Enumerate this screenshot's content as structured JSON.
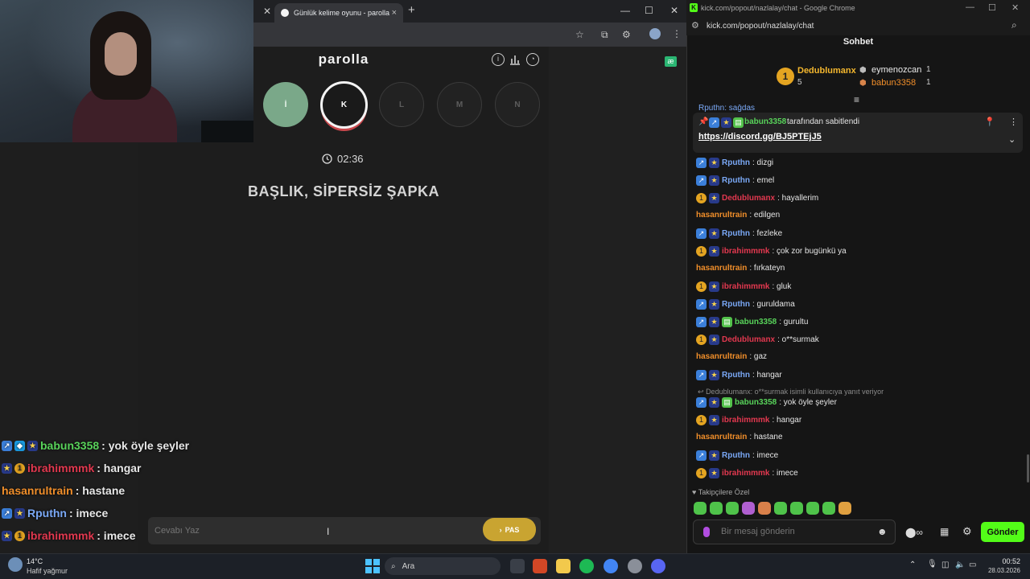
{
  "browser": {
    "tab_title": "Günlük kelime oyunu - parolla",
    "tab_close": "×",
    "new_tab": "+",
    "minimize": "—",
    "maximize": "☐",
    "close": "✕"
  },
  "game": {
    "logo": "parolla",
    "letters": [
      {
        "letter": "İ",
        "state": "done"
      },
      {
        "letter": "K",
        "state": "current"
      },
      {
        "letter": "L",
        "state": "todo"
      },
      {
        "letter": "M",
        "state": "todo"
      },
      {
        "letter": "N",
        "state": "todo"
      }
    ],
    "timer": "02:36",
    "clue": "BAŞLIK, SİPERSİZ ŞAPKA",
    "answer_placeholder": "Cevabı Yaz",
    "pass_label": "PAS",
    "pass_color": "#c9a431"
  },
  "overlay_chat": [
    {
      "user": "babun3358",
      "text": ": yok öyle şeyler",
      "color": "#58d35a"
    },
    {
      "user": "ibrahimmmk",
      "text": ": hangar",
      "color": "#e2384f"
    },
    {
      "user": "hasanrultrain",
      "text": ": hastane",
      "color": "#f08e2a"
    },
    {
      "user": "Rputhn",
      "text": ": imece",
      "color": "#7aa8f5"
    },
    {
      "user": "ibrahimmmk",
      "text": ": imece",
      "color": "#e2384f"
    }
  ],
  "chat": {
    "window_title": "kick.com/popout/nazlalay/chat - Google Chrome",
    "address": "kick.com/popout/nazlalay/chat",
    "header": "Sohbet",
    "leaderboard": {
      "first": {
        "rank": "1",
        "name": "Dedublumanx",
        "count": "5"
      },
      "second": {
        "name": "eymenozcan",
        "count": "1"
      },
      "third": {
        "name": "babun3358",
        "count": "1"
      }
    },
    "pinned": {
      "by_user": "babun3358",
      "by_text": "tarafından sabitlendi",
      "link": "https://discord.gg/BJ5PTEjJ5"
    },
    "partial_top": "Rputhn: sağdas",
    "messages": [
      {
        "user": "Rputhn",
        "text": ": dizgi",
        "cls": "u-blue"
      },
      {
        "user": "Rputhn",
        "text": ": emel",
        "cls": "u-blue"
      },
      {
        "user": "Dedublumanx",
        "text": ": hayallerim",
        "cls": "u-red"
      },
      {
        "user": "hasanrultrain",
        "text": ": edilgen",
        "cls": "u-orange"
      },
      {
        "user": "Rputhn",
        "text": ": fezleke",
        "cls": "u-blue"
      },
      {
        "user": "ibrahimmmk",
        "text": ": çok zor bugünkü ya",
        "cls": "u-red"
      },
      {
        "user": "hasanrultrain",
        "text": ": fırkateyn",
        "cls": "u-orange"
      },
      {
        "user": "ibrahimmmk",
        "text": ": gluk",
        "cls": "u-red"
      },
      {
        "user": "Rputhn",
        "text": ": guruldama",
        "cls": "u-blue"
      },
      {
        "user": "babun3358",
        "text": ": gurultu",
        "cls": "u-green"
      },
      {
        "user": "Dedublumanx",
        "text": ": o**surmak",
        "cls": "u-red"
      },
      {
        "user": "hasanrultrain",
        "text": ": gaz",
        "cls": "u-orange"
      },
      {
        "user": "Rputhn",
        "text": ": hangar",
        "cls": "u-blue"
      },
      {
        "user": "babun3358",
        "text": ": yok öyle şeyler",
        "cls": "u-green"
      },
      {
        "user": "ibrahimmmk",
        "text": ": hangar",
        "cls": "u-red"
      },
      {
        "user": "hasanrultrain",
        "text": ": hastane",
        "cls": "u-orange"
      },
      {
        "user": "Rputhn",
        "text": ": imece",
        "cls": "u-blue"
      },
      {
        "user": "ibrahimmmk",
        "text": ": imece",
        "cls": "u-red"
      }
    ],
    "reply_note": "Dedublumanx: o**surmak isimli kullanıcıya yanıt veriyor",
    "followers_only": "Takipçilere Özel",
    "input_placeholder": "Bir mesaj gönderin",
    "send_label": "Gönder",
    "send_color": "#53fc18"
  },
  "taskbar": {
    "temp": "14°C",
    "weather": "Hafif yağmur",
    "search": "Ara",
    "time": "00:52",
    "date": "28.03.2026"
  }
}
